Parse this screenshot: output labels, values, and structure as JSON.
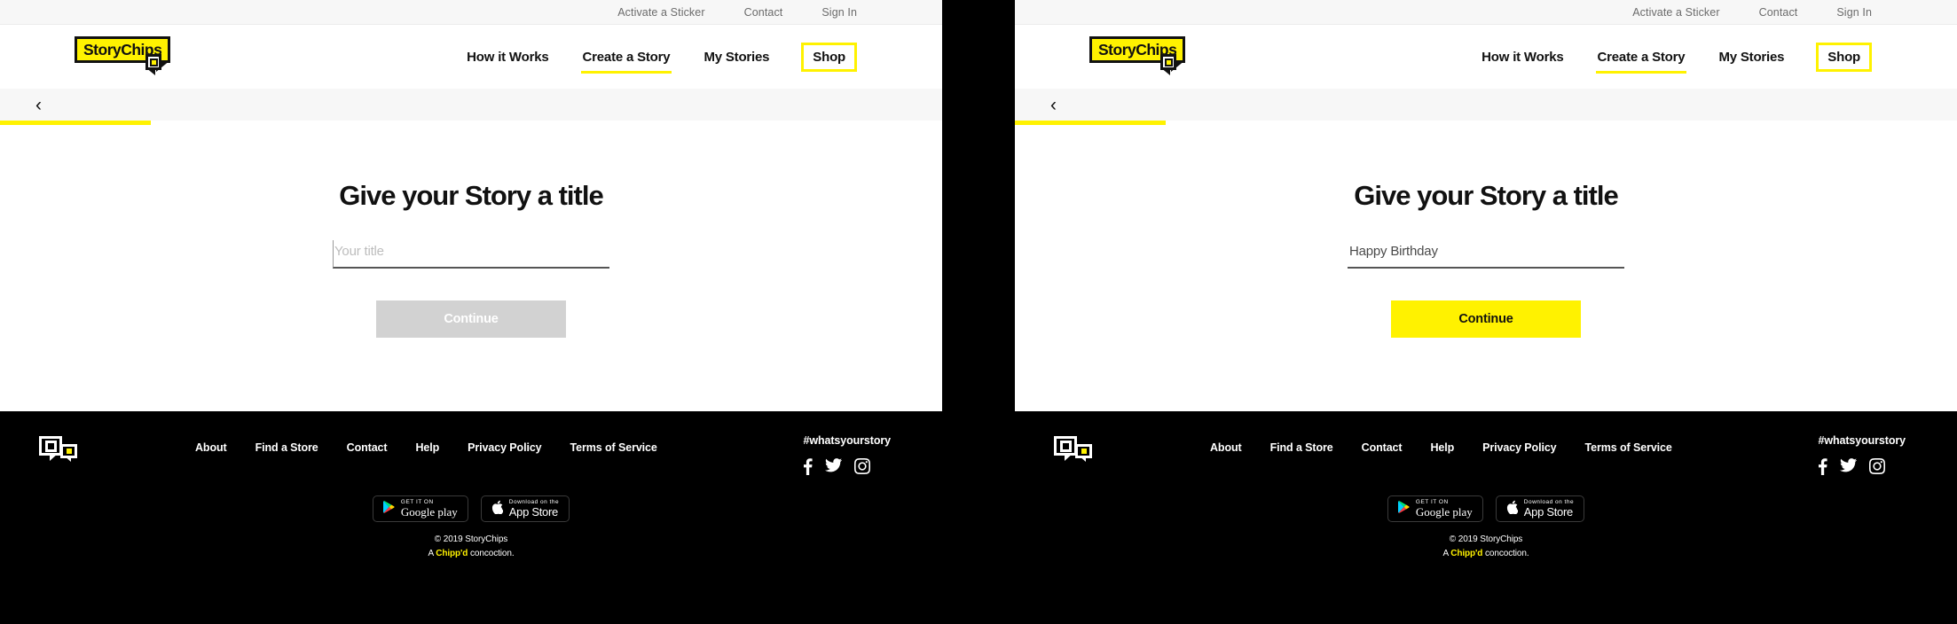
{
  "colors": {
    "brand_yellow": "#FFF200",
    "text_dark": "#111111",
    "disabled_grey": "#D2D2D2",
    "footer_bg": "#000000",
    "strip_bg": "#F7F7F7"
  },
  "utilbar": {
    "items": [
      {
        "label": "Activate a Sticker",
        "name": "activate-a-sticker"
      },
      {
        "label": "Contact",
        "name": "contact"
      },
      {
        "label": "Sign In",
        "name": "sign-in"
      }
    ]
  },
  "brand": {
    "logo_text": "StoryChips",
    "logo_icon": "speech-bubble-chip-icon"
  },
  "mainnav": {
    "items": [
      {
        "label": "How it Works",
        "state": "default"
      },
      {
        "label": "Create a Story",
        "state": "active-underline"
      },
      {
        "label": "My Stories",
        "state": "default"
      },
      {
        "label": "Shop",
        "state": "boxed-yellow"
      }
    ]
  },
  "substrip": {
    "back_icon": "chevron-left-icon",
    "back_label": "‹",
    "progress_percent": 16
  },
  "panels": [
    {
      "id": "empty-state",
      "main": {
        "title": "Give your Story a title",
        "input": {
          "value": "",
          "placeholder": "Your title",
          "caret_visible": true
        },
        "cta": {
          "label": "Continue",
          "enabled": false
        }
      }
    },
    {
      "id": "filled-state",
      "main": {
        "title": "Give your Story a title",
        "input": {
          "value": "Happy Birthday",
          "placeholder": "Your title",
          "caret_visible": false
        },
        "cta": {
          "label": "Continue",
          "enabled": true
        }
      }
    }
  ],
  "footer": {
    "mark_icon": "dual-speech-bubble-icon",
    "links": [
      "About",
      "Find a Store",
      "Contact",
      "Help",
      "Privacy Policy",
      "Terms of Service"
    ],
    "hashtag": "#whatsyourstory",
    "social": [
      {
        "name": "facebook-icon",
        "label": "Facebook"
      },
      {
        "name": "twitter-icon",
        "label": "Twitter"
      },
      {
        "name": "instagram-icon",
        "label": "Instagram"
      }
    ],
    "badges": [
      {
        "name": "google-play-badge",
        "top": "GET IT ON",
        "bottom": "Google play",
        "icon": "google-play-icon"
      },
      {
        "name": "app-store-badge",
        "top": "Download on the",
        "bottom": "App Store",
        "icon": "apple-icon"
      }
    ],
    "copyright": "© 2019 StoryChips",
    "tagline_before": "A ",
    "tagline_brand": "Chipp'd",
    "tagline_after": " concoction."
  }
}
